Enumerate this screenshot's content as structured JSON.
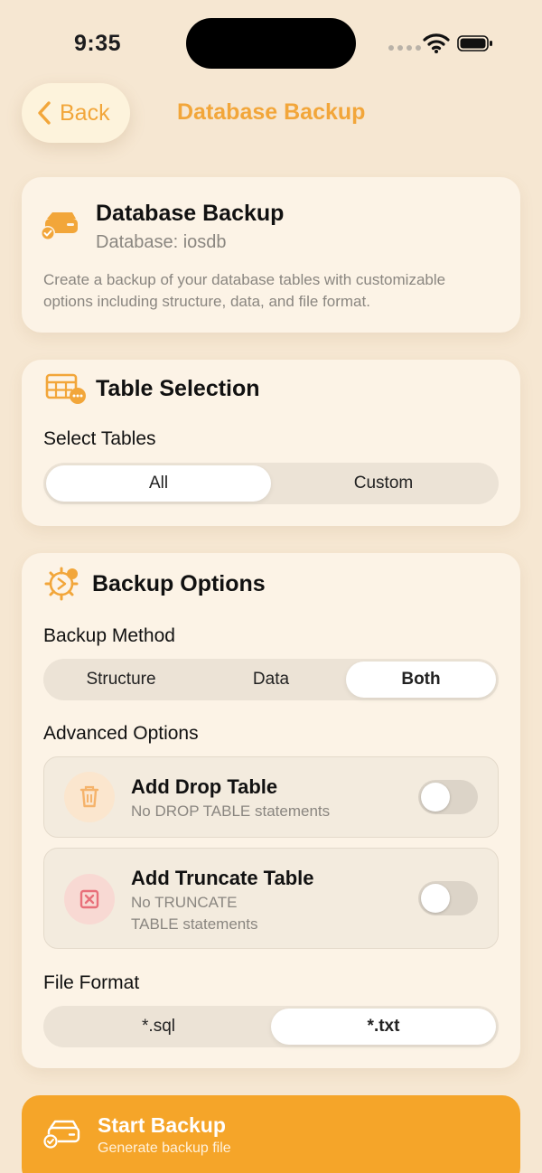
{
  "status": {
    "time": "9:35"
  },
  "nav": {
    "back_label": "Back",
    "title": "Database Backup"
  },
  "info": {
    "title": "Database Backup",
    "subtitle": "Database: iosdb",
    "description": "Create a backup of your database tables with customizable options including structure, data, and file format."
  },
  "tables": {
    "title": "Table Selection",
    "label": "Select Tables",
    "options": [
      "All",
      "Custom"
    ],
    "selected": "All"
  },
  "backup": {
    "title": "Backup Options",
    "method_label": "Backup Method",
    "methods": [
      "Structure",
      "Data",
      "Both"
    ],
    "selected_method": "Both",
    "advanced_label": "Advanced Options",
    "drop": {
      "title": "Add Drop Table",
      "subtitle": "No DROP TABLE statements",
      "enabled": false
    },
    "truncate": {
      "title": "Add Truncate Table",
      "subtitle_line1": "No TRUNCATE",
      "subtitle_line2": "TABLE statements",
      "enabled": false
    },
    "format_label": "File Format",
    "formats": [
      "*.sql",
      "*.txt"
    ],
    "selected_format": "*.txt"
  },
  "action": {
    "title": "Start Backup",
    "subtitle": "Generate backup file"
  },
  "colors": {
    "accent": "#F2A63A",
    "background": "#F6E7D2",
    "card": "#FCF3E6",
    "button": "#F5A529"
  }
}
